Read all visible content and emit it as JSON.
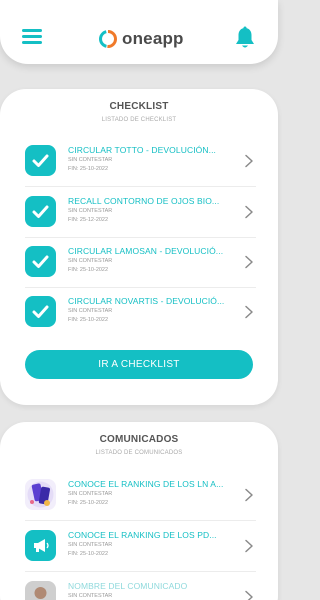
{
  "app": {
    "logo_text": "oneapp"
  },
  "colors": {
    "accent": "#14bfc4",
    "background": "#e6e6e6"
  },
  "header": {
    "menu_icon": "hamburger-menu-icon",
    "notification_icon": "bell-icon"
  },
  "checklist": {
    "title": "CHECKLIST",
    "subtitle": "LISTADO DE CHECKLIST",
    "items": [
      {
        "title": "CIRCULAR TOTTO - DEVOLUCIÓN...",
        "status": "SIN CONTESTAR",
        "date": "FIN: 25-10-2022"
      },
      {
        "title": "RECALL CONTORNO DE OJOS BIO...",
        "status": "SIN CONTESTAR",
        "date": "FIN: 25-12-2022"
      },
      {
        "title": "CIRCULAR LAMOSAN - DEVOLUCIÓ...",
        "status": "SIN CONTESTAR",
        "date": "FIN: 25-10-2022"
      },
      {
        "title": "CIRCULAR NOVARTIS - DEVOLUCIÓ...",
        "status": "SIN CONTESTAR",
        "date": "FIN: 25-10-2022"
      }
    ],
    "button_label": "IR A CHECKLIST"
  },
  "comunicados": {
    "title": "COMUNICADOS",
    "subtitle": "LISTADO DE COMUNICADOS",
    "items": [
      {
        "title": "CONOCE EL RANKING DE LOS LN A...",
        "status": "SIN CONTESTAR",
        "date": "FIN: 25-10-2022",
        "thumb": "ranking-image"
      },
      {
        "title": "CONOCE EL RANKING DE LOS PD...",
        "status": "SIN CONTESTAR",
        "date": "FIN: 25-10-2022",
        "thumb": "megaphone-icon"
      },
      {
        "title": "NOMBRE DEL COMUNICADO",
        "status": "SIN CONTESTAR",
        "date": "",
        "thumb": "person-photo"
      }
    ]
  }
}
